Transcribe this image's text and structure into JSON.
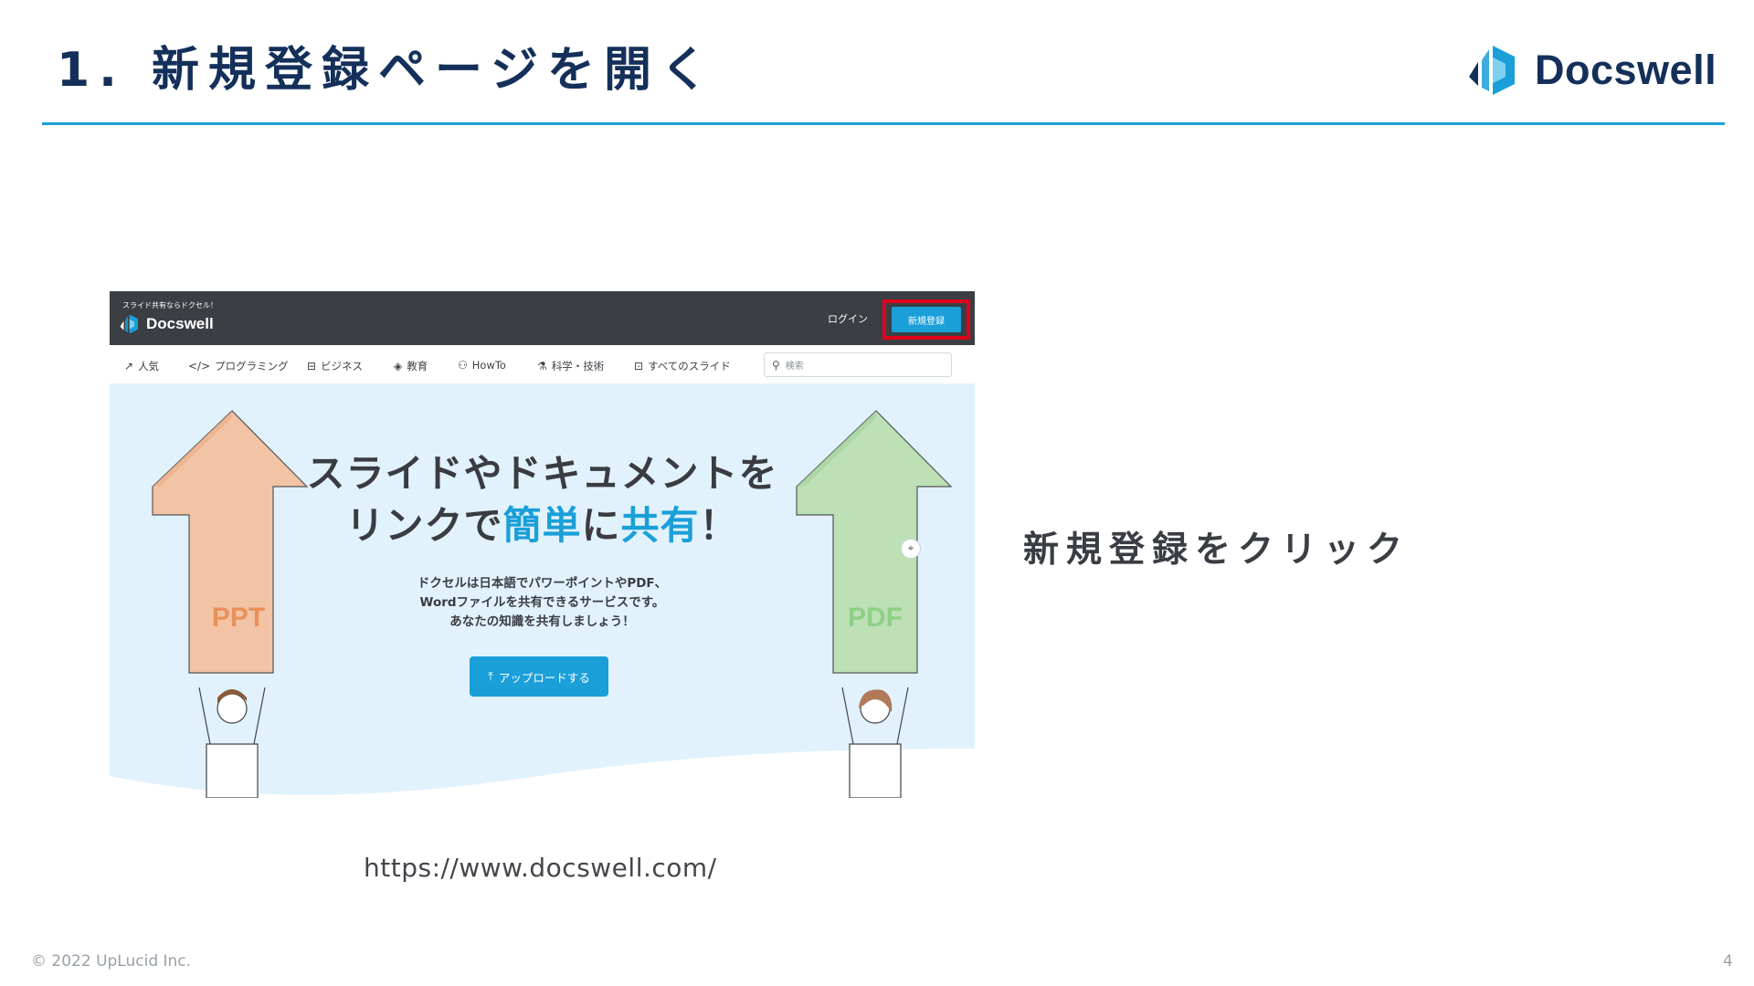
{
  "slide": {
    "title": "1.  新規登録ページを開く",
    "brand_name": "Docswell",
    "instruction": "新規登録をクリック",
    "url_caption": "https://www.docswell.com/",
    "copyright": "© 2022 UpLucid Inc.",
    "page_number": "4"
  },
  "site": {
    "tagline": "スライド共有ならドクセル！",
    "logo_name": "Docswell",
    "login_label": "ログイン",
    "signup_label": "新規登録",
    "categories": [
      {
        "icon": "trending-icon",
        "label": "人気"
      },
      {
        "icon": "code-icon",
        "label": "プログラミング"
      },
      {
        "icon": "briefcase-icon",
        "label": "ビジネス"
      },
      {
        "icon": "graduation-cap-icon",
        "label": "教育"
      },
      {
        "icon": "people-icon",
        "label": "HowTo"
      },
      {
        "icon": "flask-icon",
        "label": "科学・技術"
      },
      {
        "icon": "presentation-icon",
        "label": "すべてのスライド"
      }
    ],
    "search_placeholder": "検索",
    "hero": {
      "line1": "スライドやドキュメントを",
      "line2_a": "リンクで",
      "line2_b": "簡単",
      "line2_c": "に",
      "line2_d": "共有",
      "line2_e": "！",
      "desc": [
        "ドクセルは日本語でパワーポイントやPDF、",
        "Wordファイルを共有できるサービスです。",
        "あなたの知識を共有しましょう！"
      ],
      "upload_label": "アップロードする",
      "left_arrow_label": "PPT",
      "right_arrow_label": "PDF"
    }
  },
  "colors": {
    "accent": "#1a9fd8",
    "navy": "#14305a",
    "header_bg": "#3b3e43",
    "highlight_red": "#e0001b",
    "hero_bg": "#e1f2fc",
    "ppt_arrow": "#f2c3a4",
    "pdf_arrow": "#bde0b6"
  }
}
